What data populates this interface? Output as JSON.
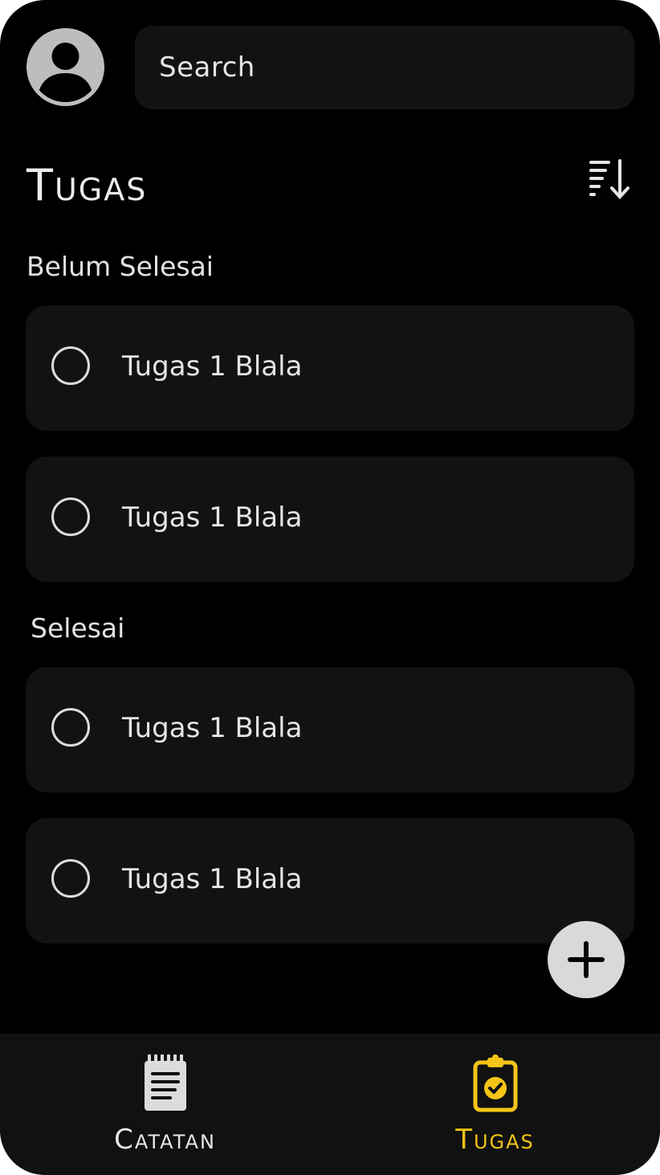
{
  "header": {
    "search_placeholder": "Search"
  },
  "page": {
    "title": "Tugas"
  },
  "sections": [
    {
      "label": "Belum Selesai",
      "tasks": [
        {
          "label": "Tugas 1 Blala",
          "done": false
        },
        {
          "label": "Tugas 1 Blala",
          "done": false
        }
      ]
    },
    {
      "label": "Selesai",
      "tasks": [
        {
          "label": "Tugas 1 Blala",
          "done": false
        },
        {
          "label": "Tugas 1 Blala",
          "done": false
        }
      ]
    }
  ],
  "bottom_nav": {
    "items": [
      {
        "label": "Catatan",
        "icon": "notepad-icon",
        "active": false
      },
      {
        "label": "Tugas",
        "icon": "clipboard-check-icon",
        "active": true
      }
    ]
  },
  "icons": {
    "avatar": "user-avatar-icon",
    "sort": "sort-descending-icon",
    "fab": "plus-icon"
  },
  "colors": {
    "background": "#000000",
    "card": "#121212",
    "text": "#e4e4e4",
    "accent_active": "#f5c518",
    "nav_inactive": "#e6e6e6",
    "fab": "#d9d9d9"
  }
}
